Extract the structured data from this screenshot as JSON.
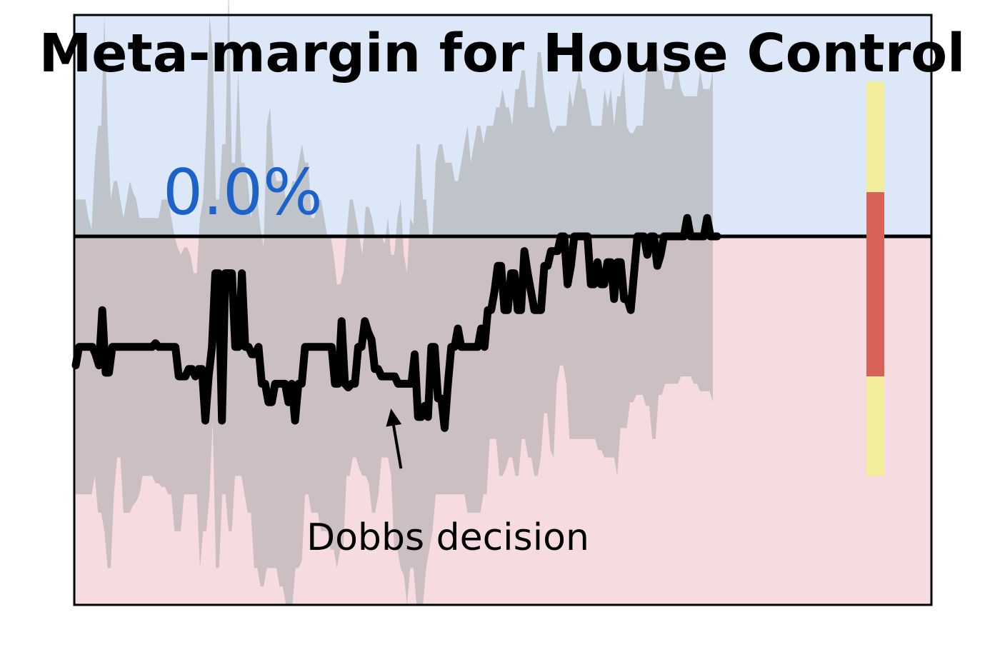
{
  "chart_data": {
    "type": "line",
    "title": "Meta-margin for House Control",
    "current_value_label": "0.0%",
    "annotation": {
      "text": "Dobbs decision",
      "x_index": 94
    },
    "xlabel": "",
    "ylabel": "",
    "ylim": [
      -10,
      6
    ],
    "zero_line": 0,
    "grid": false,
    "legend": "none",
    "colors": {
      "upper_region": "#dce7f7",
      "lower_region": "#f6dce0",
      "band": "#a8a8a8",
      "line": "#000000",
      "current_value_text": "#1d62c8",
      "bar_yellow": "#f3ee9c",
      "bar_red": "#d86257"
    },
    "series": [
      {
        "values": [
          -3.5,
          -3,
          -3,
          -3,
          -3,
          -3,
          -3.2,
          -3.5,
          -2,
          -3.7,
          -3.7,
          -3,
          -3,
          -3,
          -3,
          -3,
          -3,
          -3,
          -3,
          -3,
          -3,
          -3,
          -3,
          -3,
          -2.9,
          -3,
          -3,
          -3,
          -3,
          -3,
          -3,
          -3.8,
          -3.8,
          -3.8,
          -3.6,
          -3.6,
          -3.8,
          -3.6,
          -3.6,
          -5,
          -3.8,
          -3,
          -1,
          -1,
          -5,
          -1,
          -1,
          -1,
          -3,
          -3,
          -1,
          -3,
          -3,
          -3.2,
          -3.2,
          -3,
          -4,
          -4,
          -4.5,
          -4.5,
          -4,
          -4,
          -4,
          -4,
          -4.5,
          -4,
          -5,
          -4,
          -4,
          -3,
          -3,
          -3,
          -3,
          -3,
          -3,
          -3,
          -3,
          -3,
          -4,
          -4,
          -2.3,
          -4,
          -4.1,
          -4,
          -4,
          -3,
          -3,
          -2.3,
          -2.6,
          -2.8,
          -3.6,
          -3.6,
          -3.8,
          -3.8,
          -3.8,
          -3.8,
          -3.8,
          -4,
          -4,
          -4,
          -4,
          -4,
          -3.2,
          -4.9,
          -4.9,
          -4.6,
          -4.9,
          -3,
          -3,
          -4.4,
          -4.4,
          -5.2,
          -4,
          -3,
          -3,
          -2.5,
          -3,
          -3,
          -3,
          -3,
          -3,
          -3,
          -2.5,
          -3,
          -2,
          -2,
          -1.5,
          -0.8,
          -0.8,
          -2,
          -2,
          -1,
          -1,
          -2,
          -2,
          -0.4,
          -1,
          -1.5,
          -2,
          -2,
          -2,
          -0.8,
          -0.8,
          -0.4,
          -0.4,
          -0.4,
          0,
          0,
          -1.3,
          -0.8,
          0,
          0,
          0,
          0,
          0,
          -1.3,
          -1.3,
          -0.7,
          -1.3,
          -1.3,
          -0.7,
          -0.7,
          -1.7,
          -0.7,
          -0.7,
          -1.7,
          -1.7,
          -2,
          -1,
          0,
          0,
          0,
          -0.5,
          0,
          0,
          -0.8,
          -0.5,
          0,
          0,
          0,
          0,
          0,
          0,
          0,
          0.5,
          0,
          0,
          0,
          0,
          0,
          0.5,
          0,
          0,
          0
        ]
      }
    ],
    "band": {
      "upper": [
        1,
        1,
        1,
        1,
        0.5,
        0.2,
        2,
        3,
        3,
        6,
        3,
        1,
        1.5,
        1.5,
        1,
        0.5,
        1,
        1.5,
        1.2,
        1,
        0.5,
        0.5,
        0.5,
        0.5,
        0.5,
        0.5,
        0.5,
        1,
        1,
        1,
        0.5,
        0,
        -0.3,
        -0.5,
        -0.3,
        -0.3,
        -0.5,
        -1,
        -1,
        0.5,
        1,
        3,
        6,
        5,
        1,
        1,
        2.5,
        2.5,
        7,
        2,
        2,
        4.5,
        2,
        2,
        1.5,
        0.5,
        1,
        1,
        0.2,
        -0.3,
        3,
        3.5,
        2,
        1.5,
        1.5,
        1.5,
        1,
        1,
        1.5,
        1.5,
        2,
        2.5,
        2,
        2,
        0.5,
        0.5,
        1,
        1,
        0.5,
        0,
        0,
        -0.5,
        -1.3,
        -1.3,
        -1,
        0,
        1,
        1,
        0.5,
        0,
        -0.5,
        0.8,
        0.8,
        0.5,
        0,
        0,
        0,
        -0.2,
        0.5,
        -0.5,
        -0.5,
        0.5,
        1,
        -0.5,
        -1,
        0.5,
        0.3,
        2.5,
        2.5,
        1,
        1,
        0,
        0,
        2,
        2.5,
        2.5,
        2,
        2,
        2,
        1.5,
        1.5,
        2,
        2.5,
        3,
        2,
        2.5,
        3,
        3,
        2.5,
        3,
        3,
        3,
        3.5,
        3.5,
        4,
        3.5,
        3.5,
        3,
        4,
        4,
        4.5,
        4.5,
        3.5,
        3.5,
        3.5,
        5,
        5,
        4,
        3.5,
        3,
        2.8,
        3,
        3,
        3,
        3,
        4,
        3.5,
        4,
        4.5,
        4,
        4,
        3.5,
        3,
        3,
        3,
        3,
        4,
        3.5,
        4,
        3,
        3.8,
        3.8,
        4.5,
        3,
        2.8,
        2.8,
        3,
        3,
        3,
        4.5,
        4.5,
        5,
        5,
        4.5,
        4.5,
        4,
        4,
        4,
        4.5,
        4.5,
        4,
        3.8,
        3.8,
        3.8,
        3.8,
        3.8,
        4.5,
        4,
        4,
        4,
        4.5,
        4.2,
        4.5
      ],
      "lower": [
        -7,
        -7,
        -7,
        -7,
        -7,
        -7,
        -6.5,
        -7.5,
        -7.5,
        -8,
        -9,
        -9,
        -7,
        -6,
        -6,
        -7.5,
        -7.5,
        -7.5,
        -7.3,
        -7.2,
        -7,
        -6.5,
        -6.5,
        -6.5,
        -6.5,
        -6.7,
        -6.7,
        -6.8,
        -6.8,
        -7,
        -7,
        -8,
        -8,
        -8,
        -7,
        -7,
        -7,
        -7,
        -7,
        -9,
        -8,
        -8,
        -7,
        -5,
        -9,
        -9,
        -7,
        -7,
        -8,
        -8,
        -6.5,
        -6.5,
        -6.5,
        -7,
        -7.5,
        -7.5,
        -9,
        -9,
        -9.5,
        -9.5,
        -9,
        -9,
        -9,
        -9,
        -9.5,
        -9.5,
        -10,
        -10,
        -10,
        -9,
        -9,
        -8.8,
        -7,
        -7,
        -7.5,
        -7.5,
        -7.5,
        -8,
        -8,
        -8,
        -8.5,
        -8.5,
        -9,
        -8.5,
        -8.5,
        -6.5,
        -6.5,
        -6,
        -6,
        -6.3,
        -6.5,
        -6.5,
        -6.7,
        -7.5,
        -7.5,
        -7,
        -6,
        -6,
        -6,
        -6.5,
        -8.5,
        -8.5,
        -9,
        -9.2,
        -10,
        -9,
        -9,
        -10,
        -10,
        -10,
        -9,
        -8.5,
        -8,
        -7,
        -7,
        -7,
        -7,
        -7,
        -7,
        -7,
        -7,
        -7,
        -7,
        -7.5,
        -7.5,
        -7.5,
        -7.5,
        -7.5,
        -7,
        -7,
        -5.5,
        -5.5,
        -5.5,
        -6.5,
        -6.5,
        -6.3,
        -6,
        -6,
        -6.5,
        -6.5,
        -5.5,
        -5.5,
        -6,
        -6,
        -6.5,
        -6.5,
        -6,
        -4.8,
        -4.8,
        -5.8,
        -6,
        -4,
        -3.5,
        -3.5,
        -4,
        -5.5,
        -5.5,
        -5.5,
        -5.5,
        -5.5,
        -5.5,
        -5.5,
        -5.5,
        -5.5,
        -5.8,
        -5.8,
        -6,
        -6,
        -6,
        -6,
        -6.5,
        -5.2,
        -5.2,
        -5.2,
        -4.5,
        -4.5,
        -4.3,
        -4.3,
        -4.3,
        -4.6,
        -4.6,
        -5.5,
        -5.5,
        -4.3,
        -4.3,
        -4,
        -4,
        -4,
        -4,
        -4,
        -3.8,
        -3.8,
        -3.8,
        -3.8,
        -4,
        -4,
        -4.2,
        -4.2,
        -4.2,
        -4.2,
        -4.5
      ]
    },
    "probability_bar": {
      "segments": [
        {
          "color": "#f3ee9c",
          "from": 4.2,
          "to": 1.2
        },
        {
          "color": "#d86257",
          "from": 1.2,
          "to": -3.8
        },
        {
          "color": "#f3ee9c",
          "from": -3.8,
          "to": -6.5
        }
      ]
    }
  }
}
